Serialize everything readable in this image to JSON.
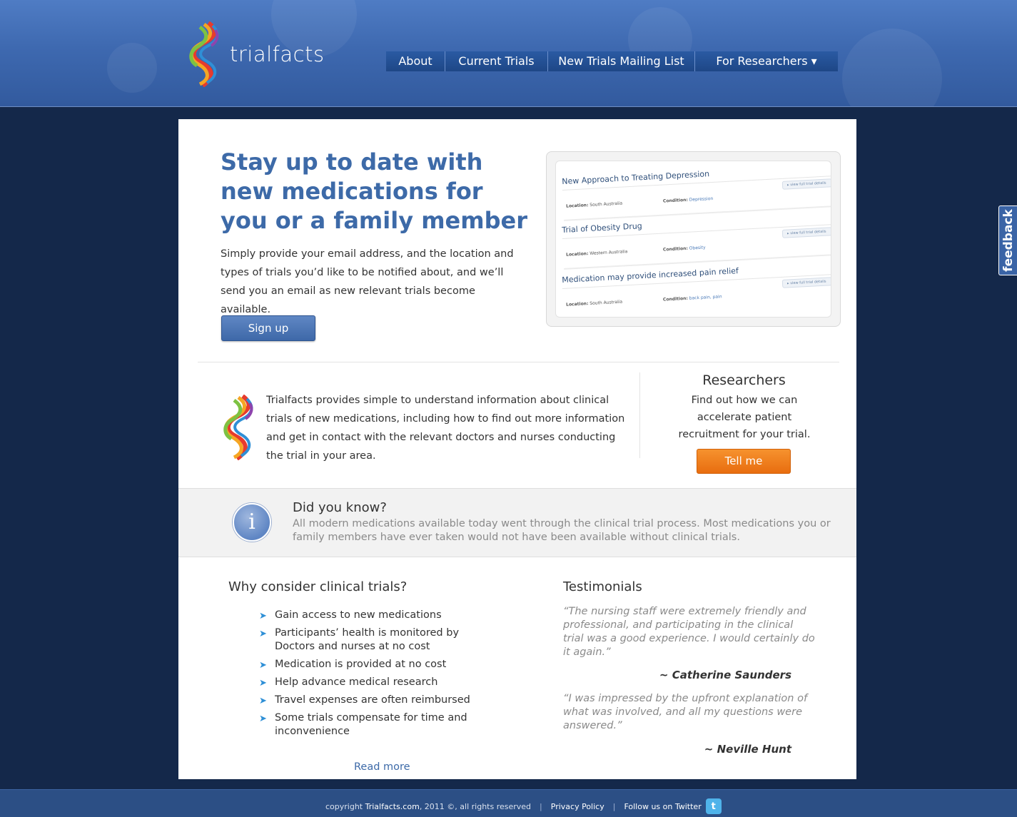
{
  "header": {
    "brand": "trialfacts",
    "nav": [
      {
        "label": "About"
      },
      {
        "label": "Current Trials"
      },
      {
        "label": "New Trials Mailing List"
      },
      {
        "label": "For Researchers ▾"
      }
    ]
  },
  "hero": {
    "title": "Stay up to date with new medications for you or a family member",
    "text": "Simply provide your email address, and the location and types of trials you’d like to be notified about, and we’ll send you an email as new relevant trials become available.",
    "signup_label": "Sign up",
    "preview": [
      {
        "title": "New Approach to Treating Depression",
        "location_label": "Location:",
        "location": "South Australia",
        "condition_label": "Condition:",
        "condition": "Depression",
        "view": "view full trial details"
      },
      {
        "title": "Trial of Obesity Drug",
        "location_label": "Location:",
        "location": "Western Australia",
        "condition_label": "Condition:",
        "condition": "Obesity",
        "view": "view full trial details"
      },
      {
        "title": "Medication may provide increased pain relief",
        "location_label": "Location:",
        "location": "South Australia",
        "condition_label": "Condition:",
        "condition": "back pain, pain",
        "view": "view full trial details"
      }
    ]
  },
  "about": {
    "text": "Trialfacts provides simple to understand information about clinical trials of new medications, including how to find out more information and get in contact with the relevant doctors and nurses conducting the trial in your area."
  },
  "researchers": {
    "title": "Researchers",
    "text": "Find out how we can accelerate patient recruitment for your trial.",
    "button_label": "Tell me"
  },
  "did_you_know": {
    "icon": "info-icon",
    "title": "Did you know?",
    "text": "All modern medications available today went through the clinical trial process. Most medications you or family members have ever taken would not have been available without clinical trials."
  },
  "why": {
    "title": "Why consider clinical trials?",
    "items": [
      "Gain access to new medications",
      "Participants’ health is monitored by Doctors and nurses at no cost",
      "Medication is provided at no cost",
      "Help advance medical research",
      "Travel expenses are often reimbursed",
      "Some trials compensate for time and inconvenience"
    ],
    "read_more": "Read more"
  },
  "testimonials": {
    "title": "Testimonials",
    "quotes": [
      {
        "text": "“The nursing staff were extremely friendly and professional, and participating in the clinical trial was a good experience. I would certainly do it again.”",
        "author": "~ Catherine Saunders"
      },
      {
        "text": "“I was impressed by the upfront explanation of what was involved, and all my questions were answered.”",
        "author": "~ Neville Hunt"
      }
    ]
  },
  "feedback_label": "feedback",
  "footer": {
    "copyright_prefix": "copyright ",
    "copyright_site": "Trialfacts.com",
    "copyright_suffix": ", 2011 ©, all rights reserved",
    "privacy": "Privacy Policy",
    "twitter": "Follow us on Twitter",
    "twitter_icon": "twitter-icon"
  },
  "colors": {
    "header_blue": "#3e69b0",
    "page_bg": "#14284a",
    "accent_orange": "#e86d0f",
    "title_blue": "#3d6aa8"
  }
}
